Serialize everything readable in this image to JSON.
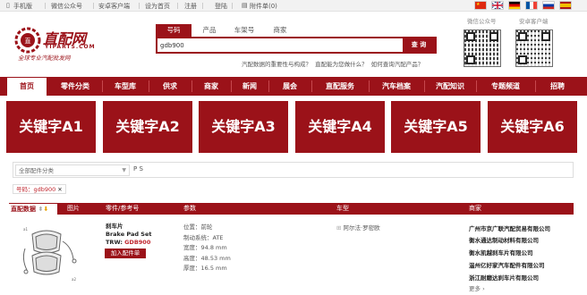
{
  "topbar": {
    "links": [
      "手机版",
      "微信公众号",
      "安卓客户端",
      "设为首页",
      "注册",
      "登陆",
      "附件单(0)"
    ]
  },
  "flags": [
    "china-flag",
    "uk-flag",
    "germany-flag",
    "france-flag",
    "russia-flag",
    "spain-flag"
  ],
  "logo": {
    "brand": "直配网",
    "domain": "YIPARTS.COM",
    "slogan": "全球专业汽配批发网"
  },
  "search": {
    "tabs": [
      "号码",
      "产品",
      "车架号",
      "商家"
    ],
    "value": "gdb900",
    "button": "查 询",
    "hot_links": [
      "汽配数据的重要性与构成？",
      "直配能为您做什么？",
      "如何查询汽配产品？"
    ]
  },
  "qr": {
    "label_1": "微信公众号",
    "label_2": "安卓客户端"
  },
  "nav": {
    "items": [
      "首页",
      "零件分类",
      "车型库",
      "供求",
      "商家",
      "新闻",
      "展会",
      "直配服务",
      "汽车档案",
      "汽配知识",
      "专题频道",
      "招聘"
    ]
  },
  "keywords": [
    "关键字A1",
    "关键字A2",
    "关键字A3",
    "关键字A4",
    "关键字A5",
    "关键字A6"
  ],
  "filter": {
    "category": "全部配件分类",
    "ps": "P  S",
    "tag": "号码：gdb900"
  },
  "table": {
    "headers": [
      "直配数据",
      "图片",
      "零件/参考号",
      "参数",
      "车型",
      "商家"
    ],
    "part": {
      "name_cn": "刹车片",
      "name_en": "Brake Pad Set",
      "ref_prefix": "TRW:",
      "ref": "GDB900",
      "add_button": "加入配件单"
    },
    "params": [
      "位置：前轮",
      "制动系统：ATE",
      "宽度：94.8 mm",
      "高度：48.53 mm",
      "厚度：16.5 mm"
    ],
    "model": "阿尔法·罗密欧",
    "suppliers": [
      "广州市京广联汽配贸易有限公司",
      "衡水通达制动材料有限公司",
      "衡水凯越刹车片有限公司",
      "温州亿好家汽车配件有限公司",
      "浙江耐磨达刹车片有限公司"
    ],
    "more": "更多 ›"
  },
  "colors": {
    "brand": "#9b1219",
    "accent_text": "#c0262e"
  }
}
